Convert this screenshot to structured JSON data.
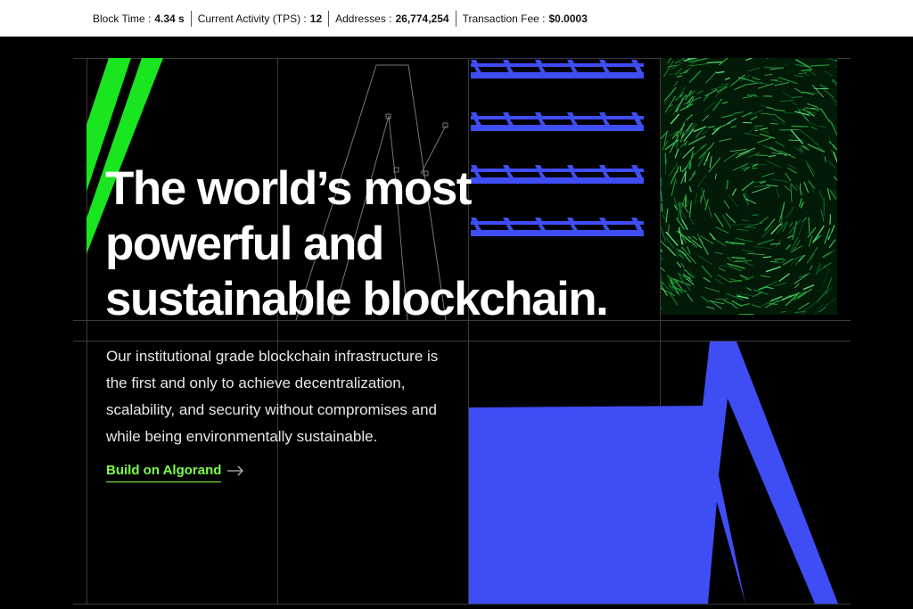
{
  "stats": {
    "block_time": {
      "label": "Block Time :",
      "value": "4.34 s"
    },
    "tps": {
      "label": "Current Activity (TPS) :",
      "value": "12"
    },
    "addresses": {
      "label": "Addresses :",
      "value": "26,774,254"
    },
    "fee": {
      "label": "Transaction Fee :",
      "value": "$0.0003"
    }
  },
  "hero": {
    "headline_lines": [
      "The world’s most",
      "powerful and",
      "sustainable blockchain."
    ],
    "description": "Our institutional grade blockchain infrastructure is the first and only to achieve decentralization, scalability, and security without compromises and while being environmentally sustainable.",
    "cta_label": "Build on Algorand"
  },
  "colors": {
    "accent_green": "#7bff4a",
    "stripe_green": "#19e61e",
    "brand_blue": "#3f4df5",
    "background": "#000000",
    "grid": "#3a3a3a"
  },
  "icons": {
    "cta_arrow": "arrow-right-icon"
  }
}
